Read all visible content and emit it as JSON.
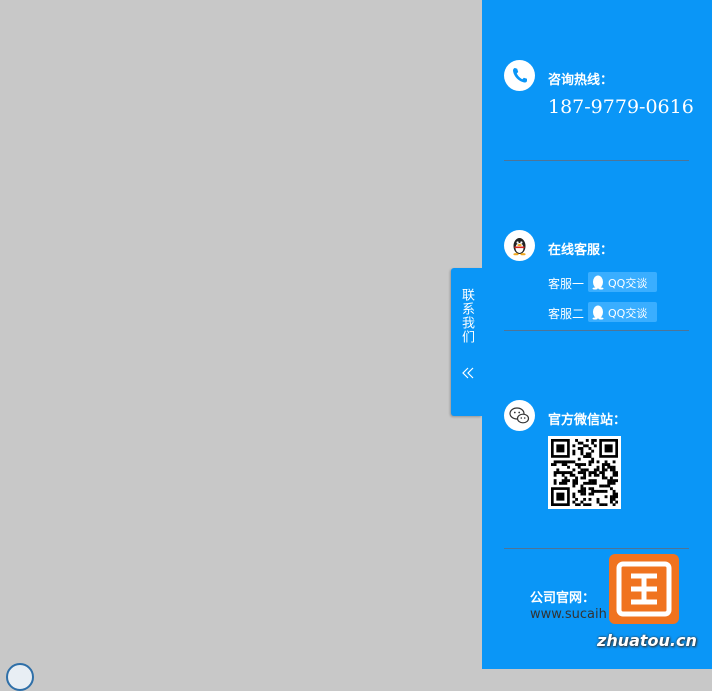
{
  "tab": {
    "label": "联系我们",
    "collapse_glyph": "«"
  },
  "hotline": {
    "title": "咨询热线：",
    "phone": "187-9779-0616"
  },
  "online_service": {
    "title": "在线客服：",
    "agents": [
      {
        "label": "客服一",
        "button": "QQ交谈"
      },
      {
        "label": "客服二",
        "button": "QQ交谈"
      }
    ]
  },
  "wechat": {
    "title": "官方微信站："
  },
  "website": {
    "title": "公司官网：",
    "url": "www.sucaih"
  },
  "watermark": {
    "text": "zhuatou.cn"
  },
  "colors": {
    "panel": "#0a96f7",
    "background": "#c8c8c8",
    "button": "#3aaeff",
    "watermark_logo": "#f0731f"
  },
  "icons": {
    "hotline": "phone-icon",
    "online_service": "qq-penguin-icon",
    "wechat": "wechat-icon",
    "button": "qq-penguin-small-icon"
  }
}
